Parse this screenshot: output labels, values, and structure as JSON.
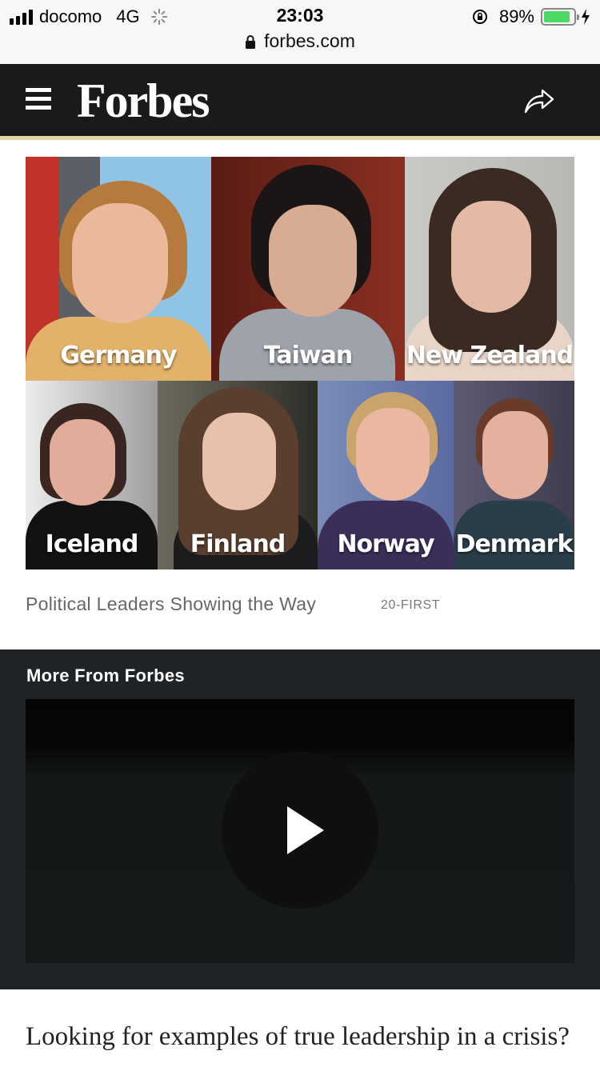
{
  "status_bar": {
    "carrier": "docomo",
    "network": "4G",
    "time": "23:03",
    "battery_percent": "89%",
    "battery_level": 0.89,
    "url": "forbes.com"
  },
  "header": {
    "logo": "Forbes",
    "background": "#1a1a1a",
    "accent_stripe": "#e2d6a3"
  },
  "hero": {
    "tiles": [
      {
        "country": "Germany"
      },
      {
        "country": "Taiwan"
      },
      {
        "country": "New Zealand"
      },
      {
        "country": "Iceland"
      },
      {
        "country": "Finland"
      },
      {
        "country": "Norway"
      },
      {
        "country": "Denmark"
      }
    ],
    "caption": "Political Leaders Showing the Way",
    "credit": "20-FIRST"
  },
  "more_from_forbes": {
    "title": "More From Forbes"
  },
  "article": {
    "lead": "Looking for examples of true leadership in a crisis? From Iceland to Taiwan and from"
  },
  "icons": [
    "menu-icon",
    "share-icon",
    "padlock-icon",
    "play-icon",
    "battery-icon",
    "signal-icon",
    "rotation-lock-icon",
    "charging-bolt-icon",
    "loading-spinner-icon"
  ]
}
